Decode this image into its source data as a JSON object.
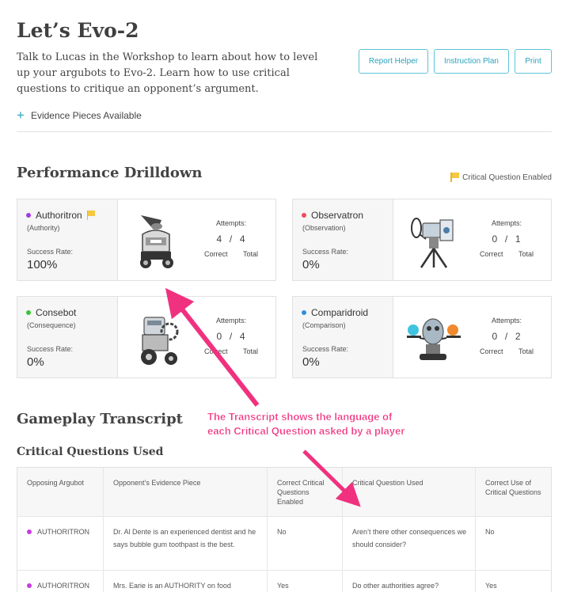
{
  "header": {
    "title": "Let’s Evo-2",
    "description": "Talk to Lucas in the Workshop to learn about how to level up your argubots to Evo-2. Learn how to use critical questions to critique an opponent’s argument.",
    "buttons": {
      "report_helper": "Report Helper",
      "instruction_plan": "Instruction Plan",
      "print": "Print"
    },
    "evidence_toggle": "Evidence Pieces Available"
  },
  "performance": {
    "title": "Performance Drilldown",
    "legend": "Critical Question Enabled",
    "cards": [
      {
        "name": "Authoritron",
        "type": "(Authority)",
        "color": "#a33be0",
        "flag": true,
        "sr_label": "Success Rate:",
        "sr": "100%",
        "att_label": "Attempts:",
        "correct": "4",
        "total": "4",
        "correct_label": "Correct",
        "total_label": "Total",
        "robot_icon": "authoritron-robot-icon"
      },
      {
        "name": "Observatron",
        "type": "(Observation)",
        "color": "#f04a5a",
        "flag": false,
        "sr_label": "Success Rate:",
        "sr": "0%",
        "att_label": "Attempts:",
        "correct": "0",
        "total": "1",
        "correct_label": "Correct",
        "total_label": "Total",
        "robot_icon": "observatron-robot-icon"
      },
      {
        "name": "Consebot",
        "type": "(Consequence)",
        "color": "#3ac43a",
        "flag": false,
        "sr_label": "Success Rate:",
        "sr": "0%",
        "att_label": "Attempts:",
        "correct": "0",
        "total": "4",
        "correct_label": "Correct",
        "total_label": "Total",
        "robot_icon": "consebot-robot-icon"
      },
      {
        "name": "Comparidroid",
        "type": "(Comparison)",
        "color": "#2f8ee0",
        "flag": false,
        "sr_label": "Success Rate:",
        "sr": "0%",
        "att_label": "Attempts:",
        "correct": "0",
        "total": "2",
        "correct_label": "Correct",
        "total_label": "Total",
        "robot_icon": "comparidroid-robot-icon"
      }
    ]
  },
  "transcript": {
    "title": "Gameplay Transcript",
    "subtitle": "Critical Questions Used",
    "columns": [
      "Opposing Argubot",
      "Opponent’s Evidence Piece",
      "Correct Critical Questions Enabled",
      "Critical Question Used",
      "Correct Use of Critical Questions"
    ],
    "rows": [
      {
        "bot": "AUTHORITRON",
        "evidence": "Dr. Al Dente is an experienced dentist and he says bubble gum toothpast is the best.",
        "enabled": "No",
        "question": "Aren’t there other consequences we should consider?",
        "correct": "No"
      },
      {
        "bot": "AUTHORITRON",
        "evidence": "Mrs. Earie is an AUTHORITY on food",
        "enabled": "Yes",
        "question": "Do other authorities agree?",
        "correct": "Yes"
      }
    ]
  },
  "annotation": {
    "line1": "The Transcript shows the language of",
    "line2": "each Critical Question asked by a player",
    "color": "#f0317f"
  },
  "colors": {
    "accent": "#2aa3bd",
    "flag": "#f5c842",
    "bot_dot": "#c93be0"
  }
}
